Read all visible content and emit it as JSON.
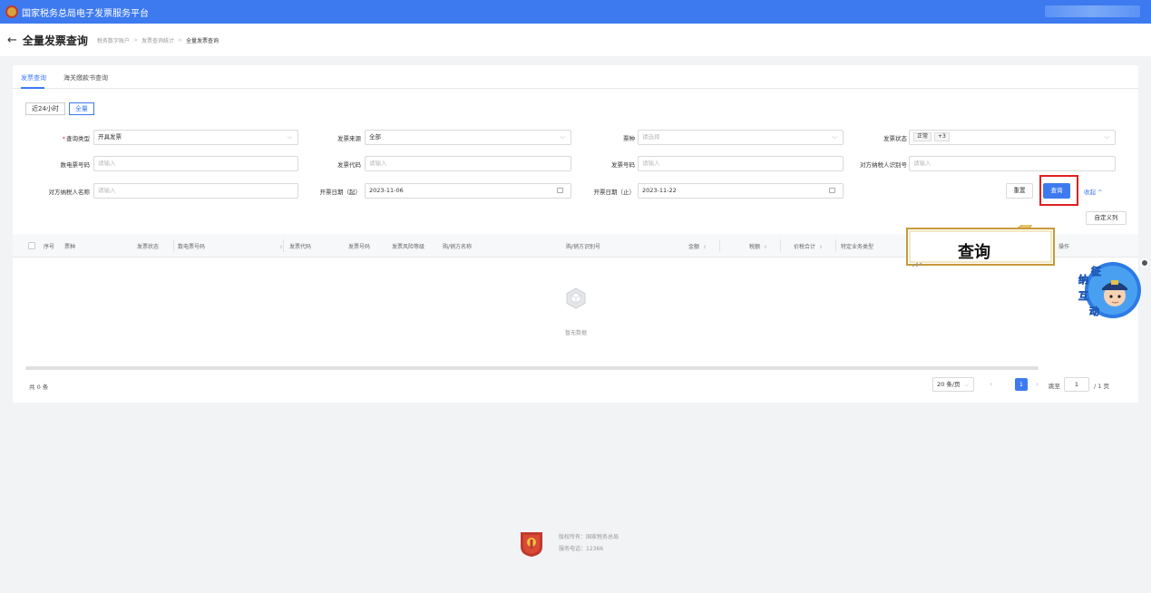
{
  "header": {
    "title": "国家税务总局电子发票服务平台"
  },
  "breadcrumb": {
    "back_icon": "←",
    "page_title": "全量发票查询",
    "items": [
      "税务数字账户",
      "发票查询统计",
      "全量发票查询"
    ]
  },
  "tabs": [
    "发票查询",
    "海关缴款书查询"
  ],
  "range": {
    "last24h": "近24小时",
    "all": "全量"
  },
  "filters": {
    "query_type": {
      "label": "查询类型",
      "value": "开具发票"
    },
    "source": {
      "label": "发票来源",
      "value": "全部"
    },
    "ticket_type": {
      "label": "票种",
      "placeholder": "请选择"
    },
    "status": {
      "label": "发票状态",
      "tag": "正常",
      "more": "+3"
    },
    "digital_no": {
      "label": "数电票号码",
      "placeholder": "请输入"
    },
    "invoice_code": {
      "label": "发票代码",
      "placeholder": "请输入"
    },
    "invoice_no": {
      "label": "发票号码",
      "placeholder": "请输入"
    },
    "counter_tax_id": {
      "label": "对方纳税人识别号",
      "placeholder": "请输入"
    },
    "counter_name": {
      "label": "对方纳税人名称",
      "placeholder": "请输入"
    },
    "date_start": {
      "label": "开票日期（起）",
      "value": "2023-11-06"
    },
    "date_end": {
      "label": "开票日期（止）",
      "value": "2023-11-22"
    }
  },
  "actions": {
    "reset": "重置",
    "query": "查询",
    "collapse": "收起 ^",
    "custom_columns": "自定义列"
  },
  "table": {
    "columns": [
      "序号",
      "票种",
      "发票状态",
      "数电票号码",
      "发票代码",
      "发票号码",
      "发票风险等级",
      "购/销方名称",
      "购/销方识别号",
      "金额",
      "税额",
      "价税合计",
      "特定业务类型",
      "操作"
    ],
    "empty_text": "暂无数据"
  },
  "pagination": {
    "total": "共 0 条",
    "page_size": "20 条/页",
    "current": "1",
    "jump_label": "跳至",
    "jump_value": "1",
    "pages_label": "/ 1 页"
  },
  "callout": {
    "text": "查询"
  },
  "mascot": {
    "chars": [
      "征",
      "纳",
      "互",
      "动"
    ]
  },
  "footer": {
    "line1": "版权所有：国家税务总局",
    "line2": "服务电话：12366"
  }
}
